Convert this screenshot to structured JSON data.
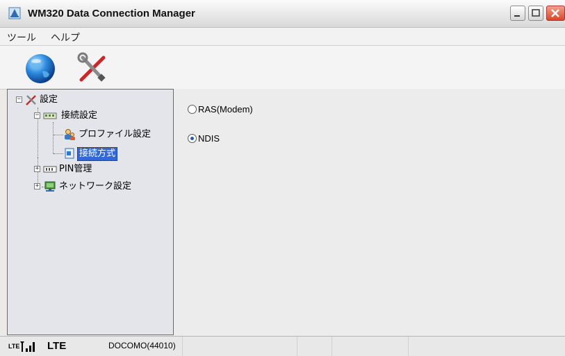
{
  "window": {
    "title": "WM320 Data Connection Manager",
    "icon": "app-icon"
  },
  "menu": {
    "items": [
      "ツール",
      "ヘルプ"
    ]
  },
  "toolbar": {
    "buttons": [
      {
        "name": "connect",
        "icon": "globe-icon"
      },
      {
        "name": "settings",
        "icon": "tools-icon"
      }
    ]
  },
  "tree": {
    "root": {
      "label": "設定",
      "icon": "tools-icon",
      "expanded": true
    },
    "connection": {
      "label": "接続設定",
      "icon": "network-card-icon",
      "expanded": true
    },
    "profile": {
      "label": "プロファイル設定",
      "icon": "users-icon"
    },
    "method": {
      "label": "接続方式",
      "icon": "document-icon",
      "selected": true
    },
    "pin": {
      "label": "PIN管理",
      "icon": "sim-icon",
      "expanded": false
    },
    "network": {
      "label": "ネットワーク設定",
      "icon": "monitor-icon",
      "expanded": false
    }
  },
  "content": {
    "options": [
      {
        "label": "RAS(Modem)",
        "checked": false
      },
      {
        "label": "NDIS",
        "checked": true
      }
    ]
  },
  "status": {
    "lte_tag": "LTE",
    "network_type": "LTE",
    "carrier": "DOCOMO(44010)"
  },
  "colors": {
    "selection": "#3168d5",
    "tree_background": "#e3e5ea",
    "close_button": "#d8462a"
  }
}
